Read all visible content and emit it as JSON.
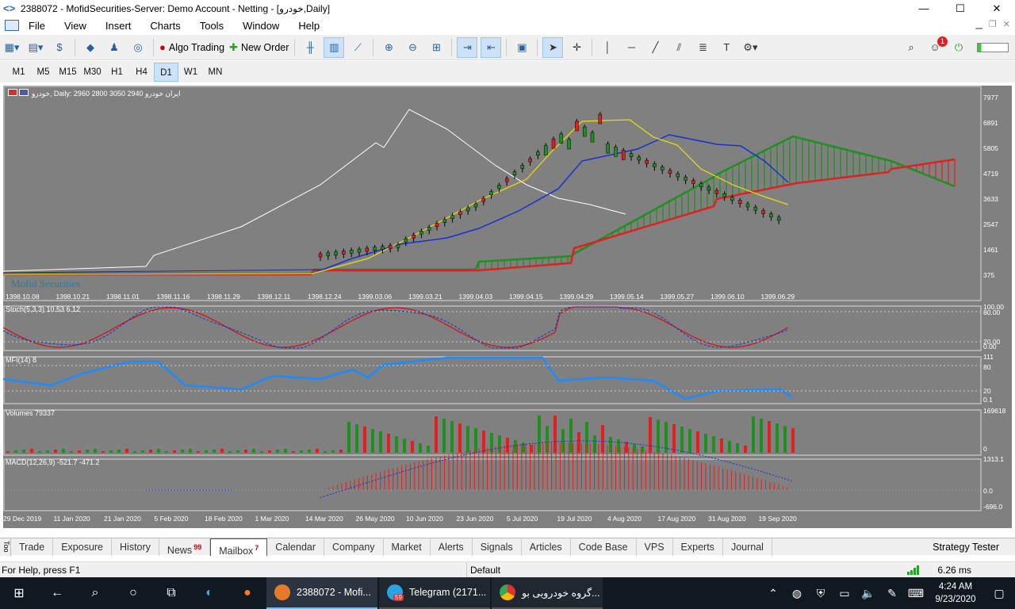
{
  "window": {
    "title": "2388072 - MofidSecurities-Server: Demo Account - Netting - [خودرو,Daily]",
    "min": "—",
    "max": "☐",
    "close": "✕"
  },
  "menu": [
    "File",
    "View",
    "Insert",
    "Charts",
    "Tools",
    "Window",
    "Help"
  ],
  "toolbar": {
    "algo_trading": "Algo Trading",
    "new_order": "New Order",
    "notification_count": "1"
  },
  "timeframes": [
    "M1",
    "M5",
    "M15",
    "M30",
    "H1",
    "H4",
    "D1",
    "W1",
    "MN"
  ],
  "active_timeframe": "D1",
  "chart": {
    "header": "خودرو, Daily:  2960 2800 3050 2940  ایران خودرو",
    "watermark": "Mofid Securities",
    "price_ticks": [
      "7977",
      "6891",
      "5805",
      "4719",
      "3633",
      "2547",
      "1461",
      "375"
    ],
    "main_dates": [
      "1398.10.08",
      "1398.10.21",
      "1398.11.01",
      "1398.11.16",
      "1398.11.29",
      "1398.12.11",
      "1398.12.24",
      "1399.03.06",
      "1399.03.21",
      "1399.04.03",
      "1399.04.15",
      "1399.04.29",
      "1399.05.14",
      "1399.05.27",
      "1399.06.10",
      "1399.06.29"
    ],
    "stoch": {
      "label": "Stoch(5,3,3) 10.53 6.12",
      "ticks": [
        "100.00",
        "80.00",
        "20.00",
        "0.00"
      ]
    },
    "mfi": {
      "label": "MFI(14) 8",
      "ticks": [
        "111",
        "80",
        "20",
        "0.1"
      ]
    },
    "volumes": {
      "label": "Volumes 79337",
      "ticks": [
        "169618",
        "0"
      ]
    },
    "macd": {
      "label": "MACD(12,26,9) -521.7 -471.2",
      "ticks": [
        "1313.1",
        "0.0",
        "-696.0"
      ]
    },
    "bottom_dates": [
      "29 Dec 2019",
      "11 Jan 2020",
      "21 Jan 2020",
      "5 Feb 2020",
      "18 Feb 2020",
      "1 Mar 2020",
      "14 Mar 2020",
      "26 May 2020",
      "10 Jun 2020",
      "23 Jun 2020",
      "5 Jul 2020",
      "19 Jul 2020",
      "4 Aug 2020",
      "17 Aug 2020",
      "31 Aug 2020",
      "19 Sep 2020"
    ],
    "colors": {
      "background": "#808080",
      "bull": "#1f8f1f",
      "bear": "#e02020",
      "kijun": "#1a2fd0",
      "tenkan": "#f0e000",
      "chikou": "#ffffff"
    }
  },
  "tabs": [
    {
      "label": "Trade"
    },
    {
      "label": "Exposure"
    },
    {
      "label": "History"
    },
    {
      "label": "News",
      "badge": "99"
    },
    {
      "label": "Mailbox",
      "badge": "7"
    },
    {
      "label": "Calendar"
    },
    {
      "label": "Company"
    },
    {
      "label": "Market"
    },
    {
      "label": "Alerts"
    },
    {
      "label": "Signals"
    },
    {
      "label": "Articles"
    },
    {
      "label": "Code Base"
    },
    {
      "label": "VPS"
    },
    {
      "label": "Experts"
    },
    {
      "label": "Journal"
    }
  ],
  "toolbox_label": "Too",
  "strategy_tester": "Strategy Tester",
  "status": {
    "help": "For Help, press F1",
    "profile": "Default",
    "ping": "6.26 ms"
  },
  "taskbar": {
    "apps": [
      {
        "label": "2388072 - Mofi..."
      },
      {
        "label": "Telegram (2171..."
      },
      {
        "label": "گروه خودرویی بو..."
      }
    ],
    "telegram_badge": "59",
    "time": "4:24 AM",
    "date": "9/23/2020"
  }
}
